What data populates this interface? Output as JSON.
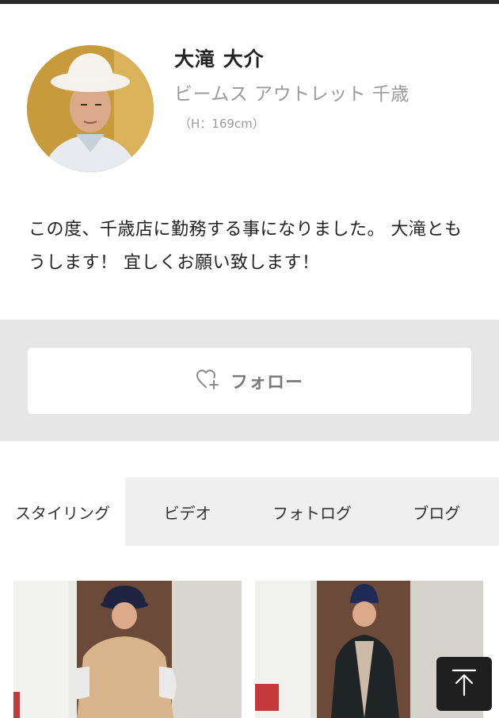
{
  "profile": {
    "name": "大滝 大介",
    "shop": "ビームス アウトレット 千歳",
    "height": "（H：169cm）",
    "bio": "この度、千歳店に勤務する事になりました。 大滝ともうします！ 宜しくお願い致します！"
  },
  "follow": {
    "label": "フォロー",
    "icon": "heart-plus-icon"
  },
  "tabs": [
    {
      "label": "スタイリング",
      "active": true
    },
    {
      "label": "ビデオ",
      "active": false
    },
    {
      "label": "フォトログ",
      "active": false
    },
    {
      "label": "ブログ",
      "active": false
    }
  ],
  "scroll_top": {
    "icon": "arrow-up-icon"
  },
  "colors": {
    "top_bar": "#2b2b2b",
    "follow_band": "#e6e6e6",
    "muted_text": "#9a9a9a",
    "scroll_button": "#1f1f1f"
  }
}
